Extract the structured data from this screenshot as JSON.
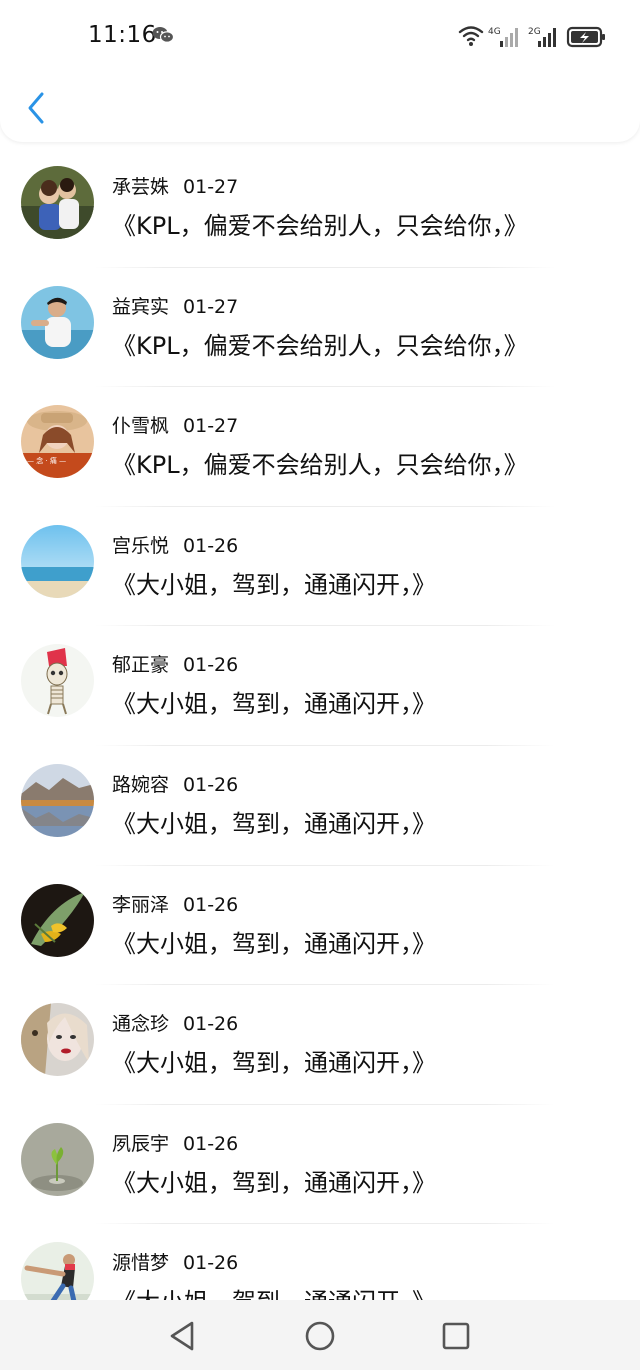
{
  "status_bar": {
    "time": "11:16",
    "wechat_icon": "wechat-icon",
    "network_1": "4G",
    "network_2": "2G"
  },
  "header": {
    "back_icon": "chevron-left-icon",
    "accent_color": "#2a93e6"
  },
  "items": [
    {
      "name": "承芸姝",
      "date": "01-27",
      "message": "《KPL，偏爱不会给别人，只会给你，》"
    },
    {
      "name": "益宾实",
      "date": "01-27",
      "message": "《KPL，偏爱不会给别人，只会给你，》"
    },
    {
      "name": "仆雪枫",
      "date": "01-27",
      "message": "《KPL，偏爱不会给别人，只会给你，》"
    },
    {
      "name": "宫乐悦",
      "date": "01-26",
      "message": "《大小姐，驾到，通通闪开，》"
    },
    {
      "name": "郁正豪",
      "date": "01-26",
      "message": "《大小姐，驾到，通通闪开，》"
    },
    {
      "name": "路婉容",
      "date": "01-26",
      "message": "《大小姐，驾到，通通闪开，》"
    },
    {
      "name": "李丽泽",
      "date": "01-26",
      "message": "《大小姐，驾到，通通闪开，》"
    },
    {
      "name": "通念珍",
      "date": "01-26",
      "message": "《大小姐，驾到，通通闪开，》"
    },
    {
      "name": "夙辰宇",
      "date": "01-26",
      "message": "《大小姐，驾到，通通闪开，》"
    },
    {
      "name": "源惜梦",
      "date": "01-26",
      "message": "《大小姐，驾到，通通闪开，》"
    }
  ],
  "nav_bar": {
    "back": "triangle-back-icon",
    "home": "circle-home-icon",
    "recents": "square-recents-icon"
  }
}
